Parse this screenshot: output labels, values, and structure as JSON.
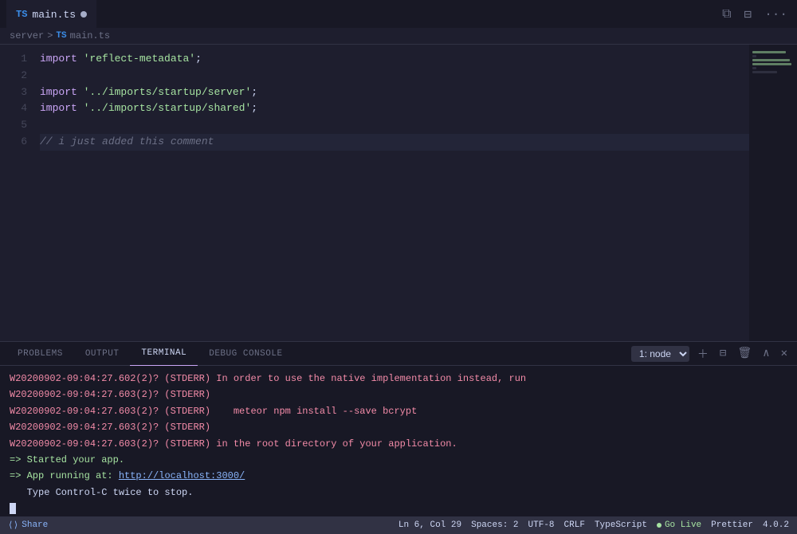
{
  "tab": {
    "filename": "main.ts",
    "unsaved": true,
    "ts_label": "TS"
  },
  "breadcrumb": {
    "server": "server",
    "separator": ">",
    "file": "main.ts",
    "ts_label": "TS"
  },
  "editor": {
    "lines": [
      {
        "num": "1",
        "tokens": [
          {
            "type": "kw-import",
            "text": "import"
          },
          {
            "type": "plain",
            "text": " "
          },
          {
            "type": "str",
            "text": "'reflect-metadata'"
          },
          {
            "type": "plain",
            "text": ";"
          }
        ]
      },
      {
        "num": "2",
        "tokens": []
      },
      {
        "num": "3",
        "tokens": [
          {
            "type": "kw-import",
            "text": "import"
          },
          {
            "type": "plain",
            "text": " "
          },
          {
            "type": "str",
            "text": "'../imports/startup/server'"
          },
          {
            "type": "plain",
            "text": ";"
          }
        ]
      },
      {
        "num": "4",
        "tokens": [
          {
            "type": "kw-import",
            "text": "import"
          },
          {
            "type": "plain",
            "text": " "
          },
          {
            "type": "str",
            "text": "'../imports/startup/shared'"
          },
          {
            "type": "plain",
            "text": ";"
          }
        ]
      },
      {
        "num": "5",
        "tokens": []
      },
      {
        "num": "6",
        "tokens": [
          {
            "type": "comment",
            "text": "// i just added this comment"
          }
        ]
      }
    ]
  },
  "terminal": {
    "tabs": [
      "PROBLEMS",
      "OUTPUT",
      "TERMINAL",
      "DEBUG CONSOLE"
    ],
    "active_tab": "TERMINAL",
    "dropdown": "1: node",
    "lines": [
      {
        "type": "stderr",
        "text": "W20200902-09:04:27.602(2)? (STDERR) In order to use the native implementation instead, run"
      },
      {
        "type": "stderr",
        "text": "W20200902-09:04:27.603(2)? (STDERR)"
      },
      {
        "type": "stderr",
        "text": "W20200902-09:04:27.603(2)? (STDERR)    meteor npm install --save bcrypt"
      },
      {
        "type": "stderr",
        "text": "W20200902-09:04:27.603(2)? (STDERR)"
      },
      {
        "type": "stderr",
        "text": "W20200902-09:04:27.603(2)? (STDERR) in the root directory of your application."
      },
      {
        "type": "success",
        "text": "=> Started your app."
      },
      {
        "type": "plain",
        "text": ""
      },
      {
        "type": "success",
        "text": "=> App running at: http://localhost:3000/"
      },
      {
        "type": "plain",
        "text": "   Type Control-C twice to stop."
      },
      {
        "type": "cursor",
        "text": ""
      }
    ]
  },
  "statusbar": {
    "share": "Share",
    "position": "Ln 6, Col 29",
    "spaces": "Spaces: 2",
    "encoding": "UTF-8",
    "eol": "CRLF",
    "language": "TypeScript",
    "go_live": "Go Live",
    "prettier": "Prettier",
    "version": "4.0.2"
  }
}
